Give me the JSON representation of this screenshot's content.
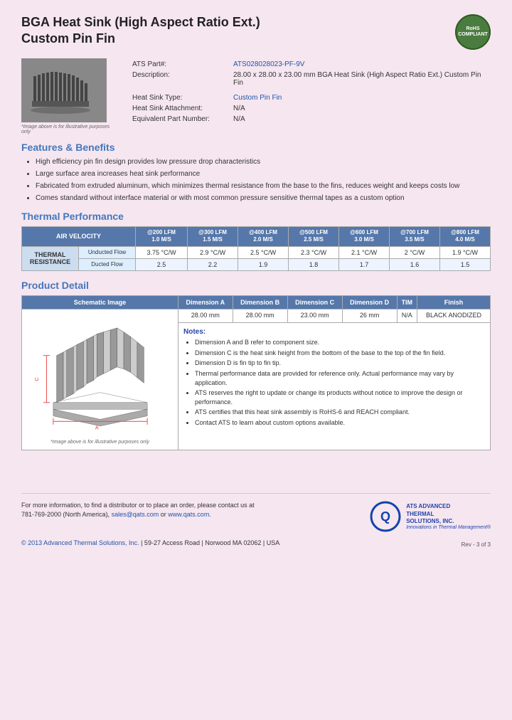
{
  "page": {
    "title_line1": "BGA Heat Sink (High Aspect Ratio Ext.)",
    "title_line2": "Custom Pin Fin"
  },
  "product": {
    "part_label": "ATS Part#:",
    "part_number": "ATS028028023-PF-9V",
    "description_label": "Description:",
    "description": "28.00 x 28.00 x 23.00 mm BGA Heat Sink (High Aspect Ratio Ext.) Custom Pin Fin",
    "heat_sink_type_label": "Heat Sink Type:",
    "heat_sink_type": "Custom Pin Fin",
    "heat_sink_attachment_label": "Heat Sink Attachment:",
    "heat_sink_attachment": "N/A",
    "equivalent_part_label": "Equivalent Part Number:",
    "equivalent_part": "N/A",
    "image_caption": "*Image above is for illustrative purposes only"
  },
  "features": {
    "section_title": "Features & Benefits",
    "items": [
      "High efficiency pin fin design provides low pressure drop characteristics",
      "Large surface area increases heat sink performance",
      "Fabricated from extruded aluminum, which minimizes thermal resistance from the base to the fins, reduces weight and keeps costs low",
      "Comes standard without interface material or with most common pressure sensitive thermal tapes as a custom option"
    ]
  },
  "thermal_performance": {
    "section_title": "Thermal Performance",
    "air_velocity_label": "AIR VELOCITY",
    "columns": [
      {
        "label": "@200 LFM",
        "sub": "1.0 M/S"
      },
      {
        "label": "@300 LFM",
        "sub": "1.5 M/S"
      },
      {
        "label": "@400 LFM",
        "sub": "2.0 M/S"
      },
      {
        "label": "@500 LFM",
        "sub": "2.5 M/S"
      },
      {
        "label": "@600 LFM",
        "sub": "3.0 M/S"
      },
      {
        "label": "@700 LFM",
        "sub": "3.5 M/S"
      },
      {
        "label": "@800 LFM",
        "sub": "4.0 M/S"
      }
    ],
    "thermal_resistance_label": "THERMAL RESISTANCE",
    "unducted_label": "Unducted Flow",
    "ducted_label": "Ducted Flow",
    "unducted_values": [
      "3.75 °C/W",
      "2.9 °C/W",
      "2.5 °C/W",
      "2.3 °C/W",
      "2.1 °C/W",
      "2 °C/W",
      "1.9 °C/W"
    ],
    "ducted_values": [
      "2.5",
      "2.2",
      "1.9",
      "1.8",
      "1.7",
      "1.6",
      "1.5"
    ]
  },
  "product_detail": {
    "section_title": "Product Detail",
    "headers": [
      "Schematic Image",
      "Dimension A",
      "Dimension B",
      "Dimension C",
      "Dimension D",
      "TIM",
      "Finish"
    ],
    "values": [
      "",
      "28.00 mm",
      "28.00 mm",
      "23.00 mm",
      "26 mm",
      "N/A",
      "BLACK ANODIZED"
    ],
    "schematic_caption": "*Image above is for illustrative purposes only",
    "notes_title": "Notes:",
    "notes": [
      "Dimension A and B refer to component size.",
      "Dimension C is the heat sink height from the bottom of the base to the top of the fin field.",
      "Dimension D is fin tip to fin tip.",
      "Thermal performance data are provided for reference only. Actual performance may vary by application.",
      "ATS reserves the right to update or change its products without notice to improve the design or performance.",
      "ATS certifies that this heat sink assembly is RoHS-6 and REACH compliant.",
      "Contact ATS to learn about custom options available."
    ]
  },
  "footer": {
    "contact_text": "For more information, to find a distributor or to place an order, please contact us at",
    "phone": "781-769-2000 (North America),",
    "email": "sales@qats.com",
    "or": "or",
    "website": "www.qats.com.",
    "copyright": "© 2013 Advanced Thermal Solutions, Inc.",
    "address": "| 59-27 Access Road  |  Norwood MA  02062  |  USA",
    "rev": "Rev - 3 of 3",
    "logo_text": "ADVANCED\nTHERMAL\nSOLUTIONS, INC.",
    "logo_tagline": "Innovations in Thermal Management®"
  },
  "rohs": {
    "text": "RoHS\nCOMPLIANT"
  }
}
